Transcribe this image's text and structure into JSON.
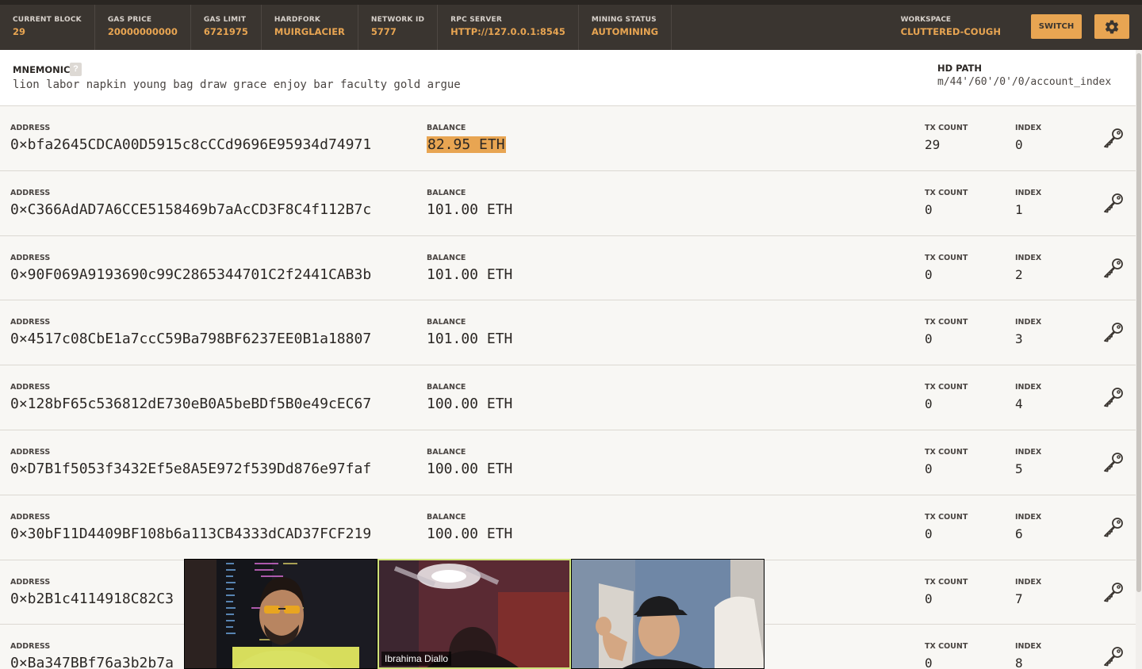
{
  "topbar": {
    "stats": [
      {
        "label": "CURRENT BLOCK",
        "value": "29"
      },
      {
        "label": "GAS PRICE",
        "value": "20000000000"
      },
      {
        "label": "GAS LIMIT",
        "value": "6721975"
      },
      {
        "label": "HARDFORK",
        "value": "MUIRGLACIER"
      },
      {
        "label": "NETWORK ID",
        "value": "5777"
      },
      {
        "label": "RPC SERVER",
        "value": "HTTP://127.0.0.1:8545"
      },
      {
        "label": "MINING STATUS",
        "value": "AUTOMINING"
      }
    ],
    "workspace_label": "WORKSPACE",
    "workspace_value": "CLUTTERED-COUGH",
    "switch_label": "SWITCH",
    "settings_icon": "gear-icon"
  },
  "mnemonic": {
    "title": "MNEMONIC",
    "help": "?",
    "words": "lion labor napkin young bag draw grace enjoy bar faculty gold argue",
    "hd_title": "HD PATH",
    "hd_path": "m/44'/60'/0'/0/account_index"
  },
  "labels": {
    "address": "ADDRESS",
    "balance": "BALANCE",
    "tx_count": "TX COUNT",
    "index": "INDEX"
  },
  "accounts": [
    {
      "address": "0×bfa2645CDCA00D5915c8cCCd9696E95934d74971",
      "balance": "82.95 ETH",
      "tx_count": "29",
      "index": "0"
    },
    {
      "address": "0×C366AdAD7A6CCE5158469b7aAcCD3F8C4f112B7c",
      "balance": "101.00 ETH",
      "tx_count": "0",
      "index": "1"
    },
    {
      "address": "0×90F069A9193690c99C2865344701C2f2441CAB3b",
      "balance": "101.00 ETH",
      "tx_count": "0",
      "index": "2"
    },
    {
      "address": "0×4517c08CbE1a7ccC59Ba798BF6237EE0B1a18807",
      "balance": "101.00 ETH",
      "tx_count": "0",
      "index": "3"
    },
    {
      "address": "0×128bF65c536812dE730eB0A5beBDf5B0e49cEC67",
      "balance": "100.00 ETH",
      "tx_count": "0",
      "index": "4"
    },
    {
      "address": "0×D7B1f5053f3432Ef5e8A5E972f539Dd876e97faf",
      "balance": "100.00 ETH",
      "tx_count": "0",
      "index": "5"
    },
    {
      "address": "0×30bF11D4409BF108b6a113CB4333dCAD37FCF219",
      "balance": "100.00 ETH",
      "tx_count": "0",
      "index": "6"
    },
    {
      "address": "0×b2B1c4114918C82C3",
      "balance": "",
      "tx_count": "0",
      "index": "7"
    },
    {
      "address": "0×Ba347BBf76a3b2b7a",
      "balance": "",
      "tx_count": "0",
      "index": "8"
    }
  ],
  "video_call": {
    "participants": [
      {
        "name": ""
      },
      {
        "name": "Ibrahima Diallo"
      },
      {
        "name": ""
      }
    ]
  },
  "colors": {
    "accent": "#e8a552",
    "topbar_bg": "#3a3530",
    "page_bg": "#f8f7f4"
  }
}
